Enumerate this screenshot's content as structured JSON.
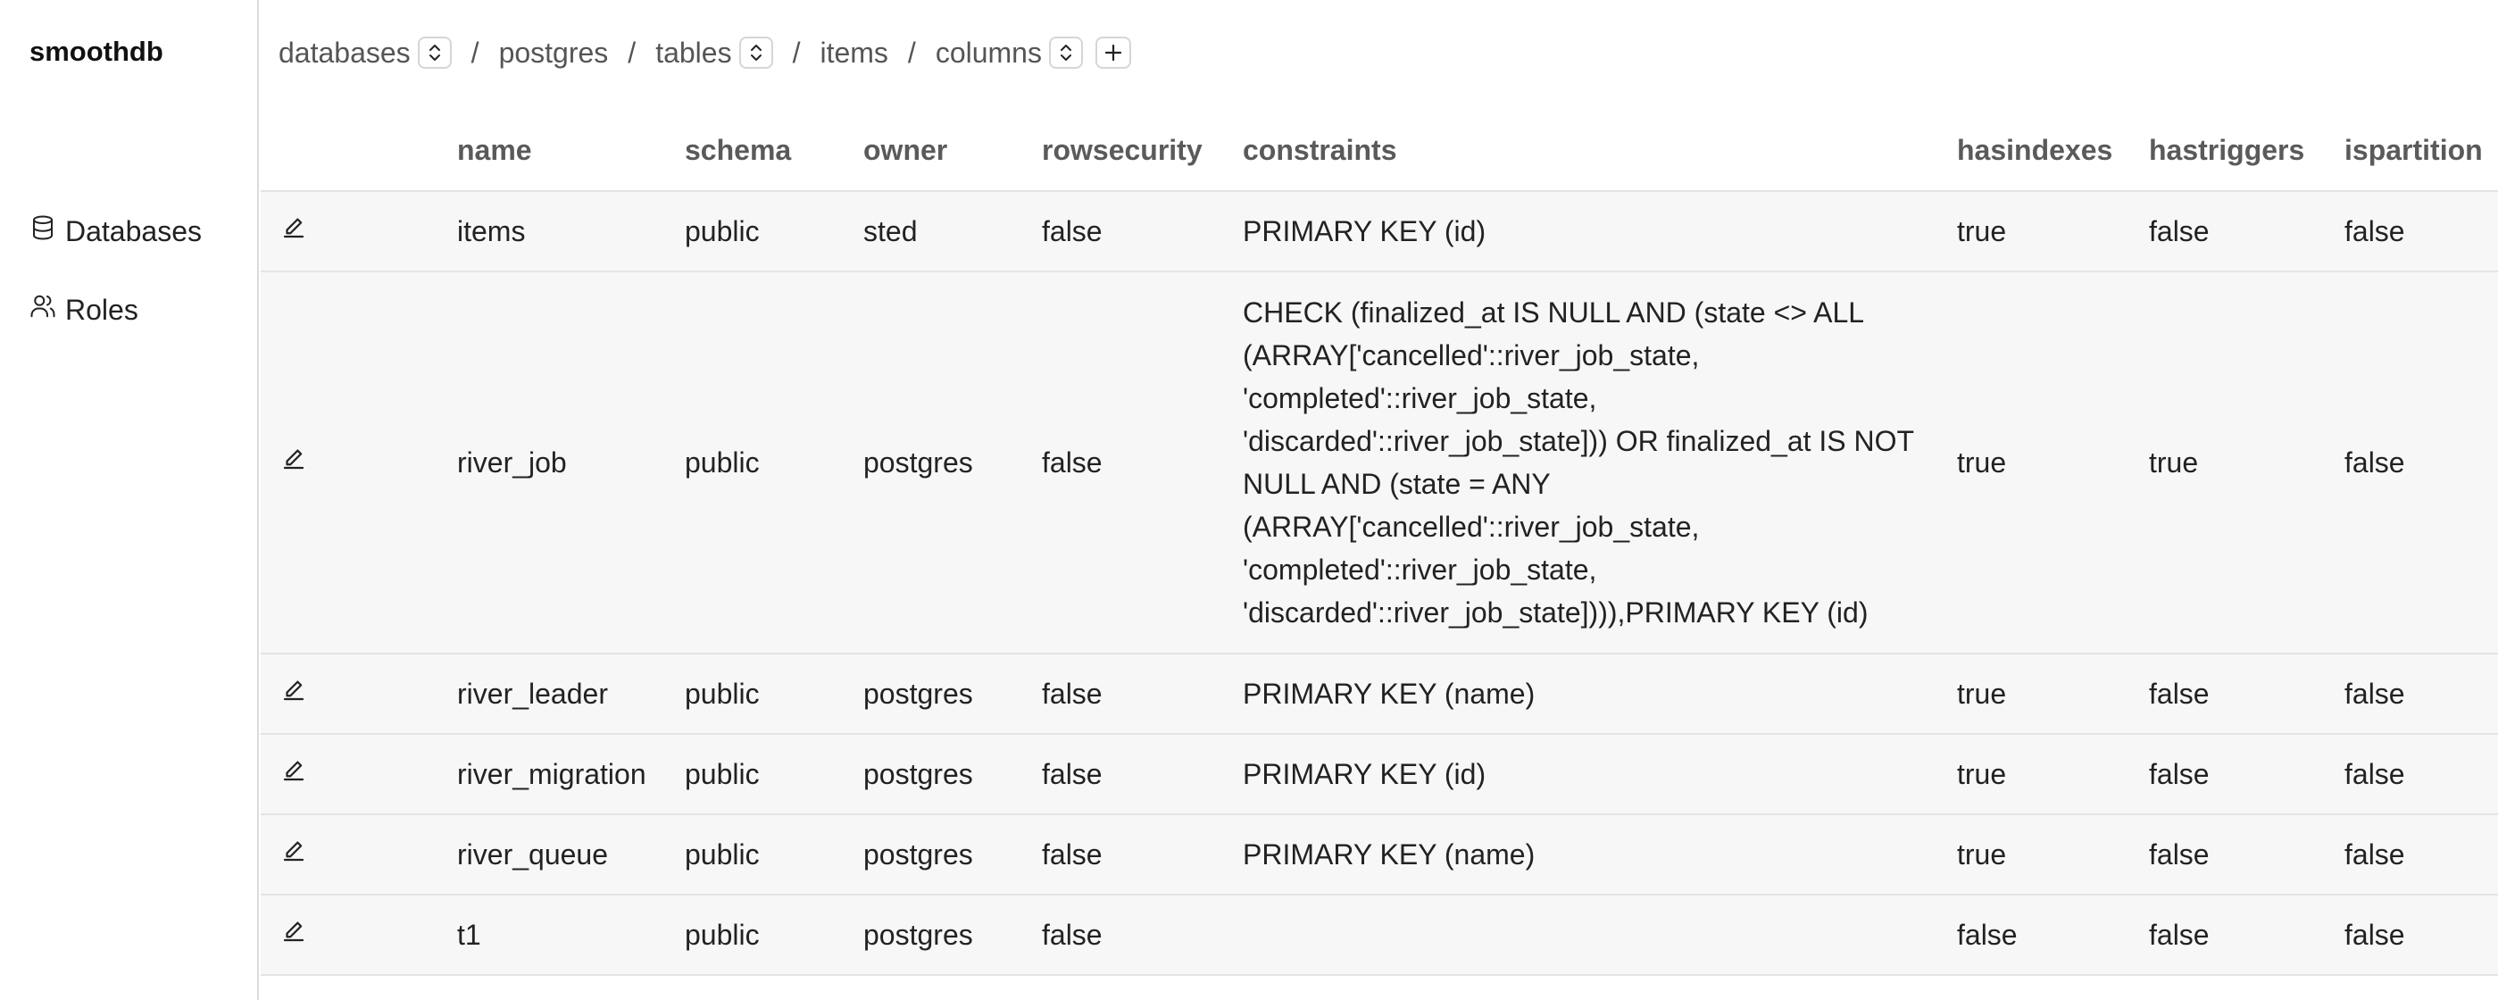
{
  "app": {
    "title": "smoothdb"
  },
  "sidebar": {
    "items": [
      {
        "label": "Databases",
        "icon": "database-icon"
      },
      {
        "label": "Roles",
        "icon": "users-icon"
      }
    ]
  },
  "breadcrumb": {
    "databases": "databases",
    "database_name": "postgres",
    "tables": "tables",
    "table_name": "items",
    "columns": "columns",
    "separator": "/"
  },
  "table": {
    "headers": [
      "name",
      "schema",
      "owner",
      "rowsecurity",
      "constraints",
      "hasindexes",
      "hastriggers",
      "ispartition"
    ],
    "rows": [
      {
        "name": "items",
        "schema": "public",
        "owner": "sted",
        "rowsecurity": "false",
        "constraints": "PRIMARY KEY (id)",
        "hasindexes": "true",
        "hastriggers": "false",
        "ispartition": "false"
      },
      {
        "name": "river_job",
        "schema": "public",
        "owner": "postgres",
        "rowsecurity": "false",
        "constraints": "CHECK (finalized_at IS NULL AND (state <> ALL (ARRAY['cancelled'::river_job_state, 'completed'::river_job_state, 'discarded'::river_job_state])) OR finalized_at IS NOT NULL AND (state = ANY (ARRAY['cancelled'::river_job_state, 'completed'::river_job_state, 'discarded'::river_job_state]))),PRIMARY KEY (id)",
        "hasindexes": "true",
        "hastriggers": "true",
        "ispartition": "false"
      },
      {
        "name": "river_leader",
        "schema": "public",
        "owner": "postgres",
        "rowsecurity": "false",
        "constraints": "PRIMARY KEY (name)",
        "hasindexes": "true",
        "hastriggers": "false",
        "ispartition": "false"
      },
      {
        "name": "river_migration",
        "schema": "public",
        "owner": "postgres",
        "rowsecurity": "false",
        "constraints": "PRIMARY KEY (id)",
        "hasindexes": "true",
        "hastriggers": "false",
        "ispartition": "false"
      },
      {
        "name": "river_queue",
        "schema": "public",
        "owner": "postgres",
        "rowsecurity": "false",
        "constraints": "PRIMARY KEY (name)",
        "hasindexes": "true",
        "hastriggers": "false",
        "ispartition": "false"
      },
      {
        "name": "t1",
        "schema": "public",
        "owner": "postgres",
        "rowsecurity": "false",
        "constraints": "",
        "hasindexes": "false",
        "hastriggers": "false",
        "ispartition": "false"
      }
    ]
  }
}
